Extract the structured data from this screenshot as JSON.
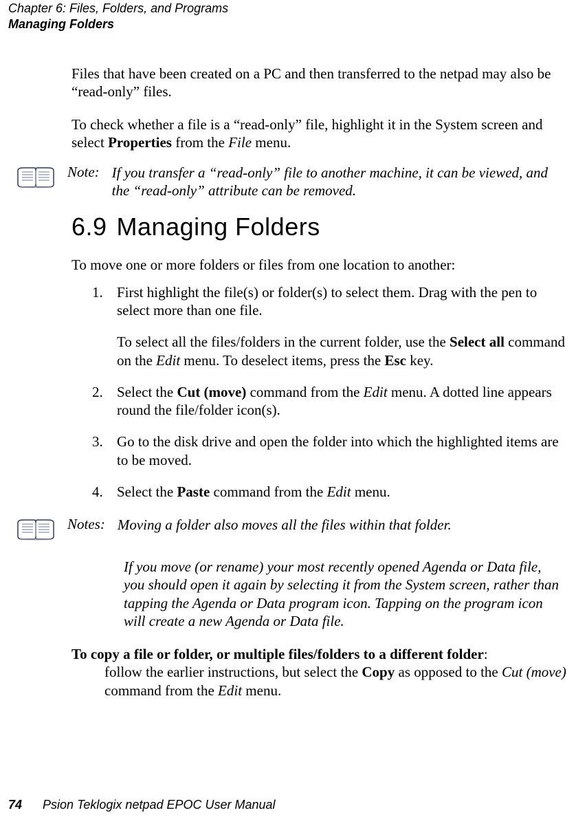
{
  "header": {
    "chapter": "Chapter 6:  Files, Folders, and Programs",
    "section": "Managing Folders"
  },
  "intro": {
    "p1_a": "Files that have been created on a PC and then transferred to the netpad may also be “read-only” files.",
    "p2_a": "To check whether a file is a “read-only” file, highlight it in the System screen and select ",
    "p2_b": "Properties",
    "p2_c": " from the ",
    "p2_d": "File",
    "p2_e": " menu."
  },
  "note1": {
    "label": "Note:",
    "text": "If you transfer a “read-only” file to another machine, it can be viewed, and the “read-only” attribute can be removed."
  },
  "section69": {
    "num": "6.9",
    "title": "Managing Folders",
    "lead": "To move one or more folders or files from one location to another:"
  },
  "steps": {
    "s1a": "First highlight the file(s) or folder(s) to select them. Drag with the pen to select more than one file.",
    "s1b_a": "To select all the files/folders in the current folder, use the ",
    "s1b_b": "Select all",
    "s1b_c": " command on the ",
    "s1b_d": "Edit",
    "s1b_e": " menu. To deselect items, press the ",
    "s1b_f": "Esc",
    "s1b_g": " key.",
    "s2_a": "Select the ",
    "s2_b": "Cut (move)",
    "s2_c": " command from the ",
    "s2_d": "Edit",
    "s2_e": " menu. A dotted line appears round the file/folder icon(s).",
    "s3": "Go to the disk drive and open the folder into which the highlighted items are to be moved.",
    "s4_a": "Select the ",
    "s4_b": "Paste",
    "s4_c": " command from the ",
    "s4_d": "Edit",
    "s4_e": " menu."
  },
  "note2": {
    "label": "Notes:",
    "text1": "Moving a folder also moves all the files within that folder.",
    "text2": "If you move (or rename) your most recently opened Agenda or Data file, you should open it again by selecting it from the System screen, rather than tapping the Agenda or Data program icon. Tapping on the program icon will create a new Agenda or Data file."
  },
  "copy": {
    "lead": "To copy a file or folder, or multiple files/folders to a different folder",
    "colon": ":",
    "body_a": "follow the earlier instructions, but select the ",
    "body_b": "Copy",
    "body_c": " as opposed to the ",
    "body_d": "Cut (move)",
    "body_e": " command from the ",
    "body_f": "Edit",
    "body_g": " menu."
  },
  "footer": {
    "page": "74",
    "title": "Psion Teklogix netpad EPOC User Manual"
  }
}
